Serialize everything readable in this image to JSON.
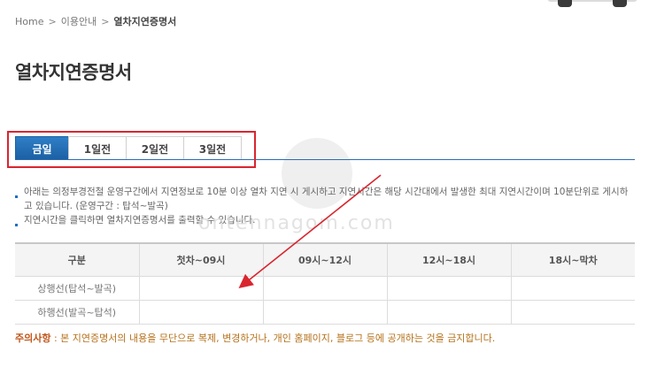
{
  "breadcrumb": {
    "home": "Home",
    "level1": "이용안내",
    "current": "열차지연증명서",
    "separator_icon": "chevron-right-icon"
  },
  "page": {
    "title": "열차지연증명서"
  },
  "tabs": [
    {
      "label": "금일",
      "active": true
    },
    {
      "label": "1일전",
      "active": false
    },
    {
      "label": "2일전",
      "active": false
    },
    {
      "label": "3일전",
      "active": false
    }
  ],
  "info": {
    "line1": "아래는 의정부경전철 운영구간에서 지연정보로 10분 이상 열차 지연 시 게시하고 지연시간은 해당 시간대에서 발생한 최대 지연시간이며 10분단위로 게시하고 있습니다. (운영구간 : 탑석~발곡)",
    "line2": "지연시간을 클릭하면 열차지연증명서를 출력할 수 있습니다."
  },
  "table": {
    "headers": [
      "구분",
      "첫차~09시",
      "09시~12시",
      "12시~18시",
      "18시~막차"
    ],
    "rows": [
      {
        "label": "상행선(탑석~발곡)",
        "cells": [
          "",
          "",
          "",
          ""
        ]
      },
      {
        "label": "하행선(발곡~탑석)",
        "cells": [
          "",
          "",
          "",
          ""
        ]
      }
    ]
  },
  "notice": {
    "prefix": "주의사항",
    "text": " : 본 지연증명서의 내용을 무단으로 복제, 변경하거나, 개인 홈페이지, 블로그 등에 공개하는 것을 금지합니다."
  },
  "watermark": {
    "text": "ontennagom.com"
  },
  "colors": {
    "accent": "#1b5fa3",
    "highlight": "#d9262f",
    "notice": "#b5711a"
  }
}
